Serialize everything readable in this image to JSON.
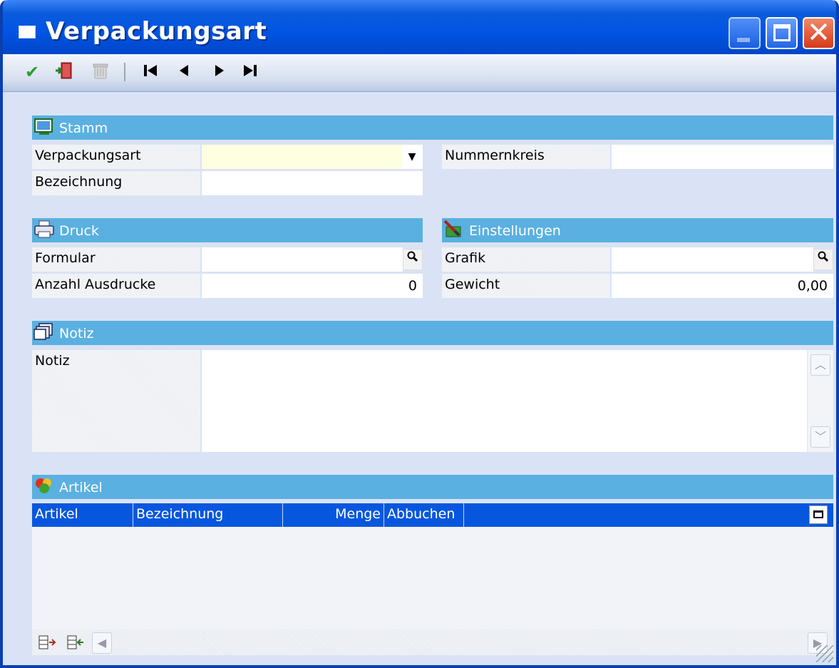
{
  "window": {
    "title": "Verpackungsart"
  },
  "toolbar": {
    "save": "✔",
    "exit": "⇥",
    "delete": "🗑",
    "first": "◀◀",
    "prev": "◀",
    "next": "▶",
    "last": "▶▶"
  },
  "stamm": {
    "header": "Stamm",
    "verpackungsart_label": "Verpackungsart",
    "verpackungsart_value": "",
    "bezeichnung_label": "Bezeichnung",
    "bezeichnung_value": "",
    "nummernkreis_label": "Nummernkreis",
    "nummernkreis_value": ""
  },
  "druck": {
    "header": "Druck",
    "formular_label": "Formular",
    "formular_value": "",
    "anzahl_label": "Anzahl Ausdrucke",
    "anzahl_value": "0"
  },
  "einstellungen": {
    "header": "Einstellungen",
    "grafik_label": "Grafik",
    "grafik_value": "",
    "gewicht_label": "Gewicht",
    "gewicht_value": "0,00"
  },
  "notiz": {
    "header": "Notiz",
    "label": "Notiz",
    "value": ""
  },
  "artikel": {
    "header": "Artikel",
    "columns": [
      "Artikel",
      "Bezeichnung",
      "Menge",
      "Abbuchen"
    ],
    "rows": []
  },
  "colors": {
    "section": "#5ab0e0",
    "grid_header": "#0757de",
    "titlebar": "#0054e3"
  },
  "icons": {
    "stamm": "monitor-icon",
    "druck": "printer-icon",
    "einstellungen": "brush-icon",
    "notiz": "notes-icon",
    "artikel": "hearts-icon"
  }
}
